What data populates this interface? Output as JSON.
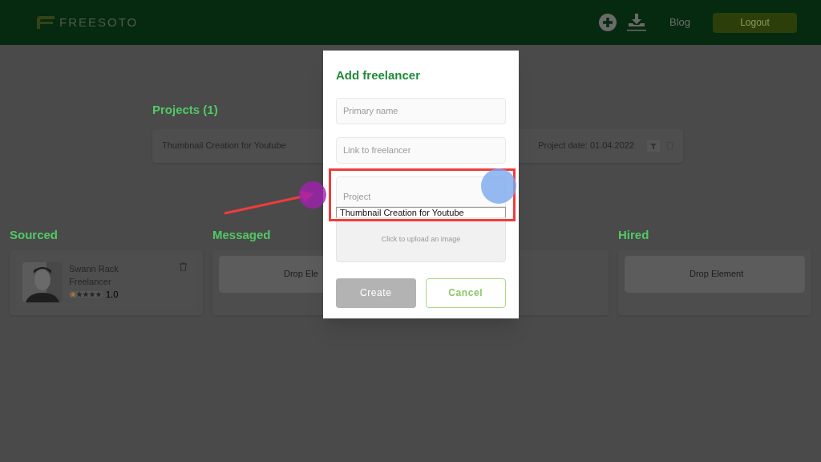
{
  "header": {
    "logo": "FREESOTO",
    "nav": [
      {
        "kind": "add"
      },
      {
        "kind": "download"
      },
      {
        "kind": "link",
        "label": "Blog"
      },
      {
        "kind": "button",
        "label": "Logout"
      }
    ]
  },
  "projects": {
    "title": "Projects (1)",
    "rows": [
      {
        "name": "Thumbnail Creation for Youtube",
        "date": "Project date: 01.04.2022"
      }
    ]
  },
  "board": {
    "columns": [
      {
        "title": "Sourced",
        "cards": [
          {
            "name": "Swann Rack",
            "role": "Freelancer",
            "stars": 1,
            "rating": "1.0"
          }
        ]
      },
      {
        "title": "Messaged",
        "drop": "Drop Ele"
      },
      {},
      {
        "title": "Hired",
        "drop": "Drop Element"
      }
    ]
  },
  "modal": {
    "title": "Add freelancer",
    "fields": [
      {
        "placeholder": "Primary name"
      },
      {
        "placeholder": "Link to freelancer"
      }
    ],
    "project": {
      "placeholder": "Project",
      "options": [
        {
          "label": "Thumbnail Creation for Youtube",
          "selected": false
        }
      ]
    },
    "upload": "Click to upload an image",
    "create": {
      "label": "Create",
      "disabled": true
    },
    "cancel": "Cancel"
  }
}
